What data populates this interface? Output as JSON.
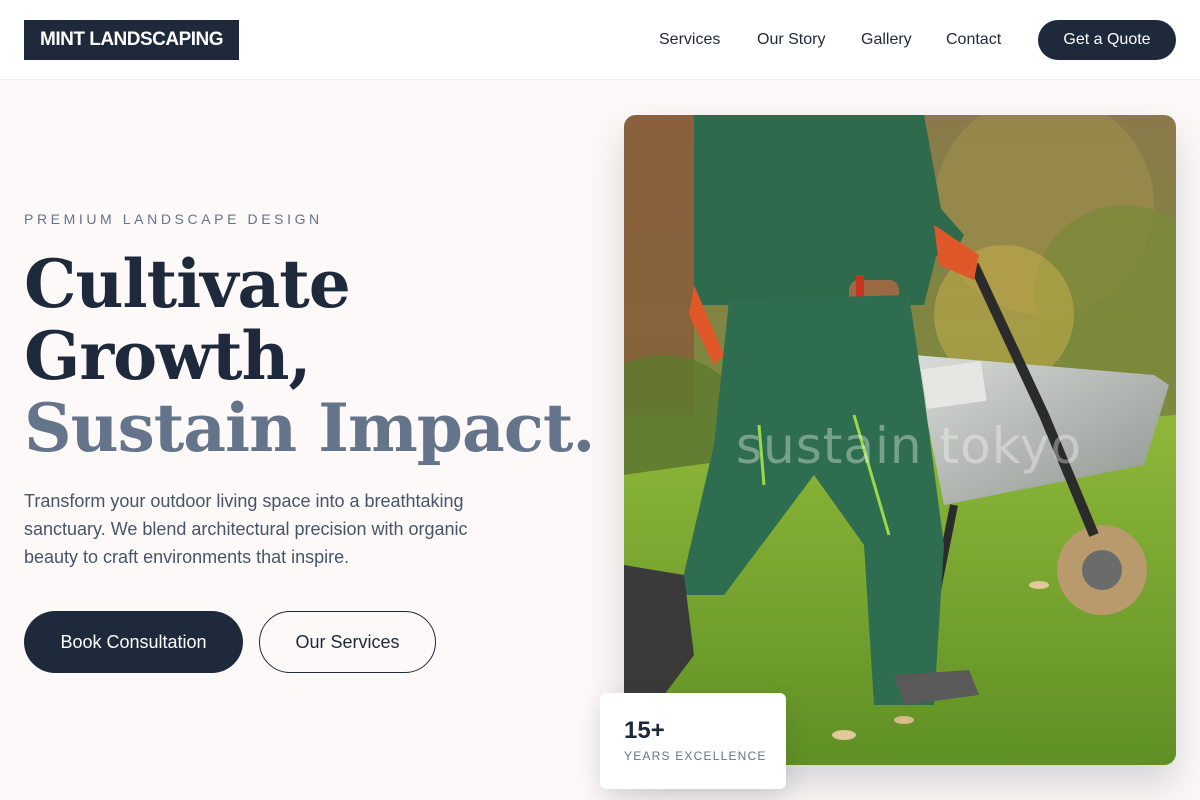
{
  "brand": {
    "logo_text": "MINT LANDSCAPING",
    "primary_color": "#1e293b",
    "muted_color": "#64748b",
    "background_color": "#fdf9f8"
  },
  "nav": {
    "items": [
      {
        "label": "Services"
      },
      {
        "label": "Our Story"
      },
      {
        "label": "Gallery"
      },
      {
        "label": "Contact"
      }
    ],
    "cta_label": "Get a Quote"
  },
  "hero": {
    "eyebrow": "PREMIUM LANDSCAPE DESIGN",
    "headline_line1": "Cultivate",
    "headline_line2": "Growth,",
    "headline_accent": "Sustain Impact.",
    "lead": "Transform your outdoor living space into a breathtaking sanctuary. We blend architectural precision with organic beauty to craft environments that inspire.",
    "primary_button": "Book Consultation",
    "secondary_button": "Our Services",
    "image_watermark": "sustain tokyo"
  },
  "stat": {
    "number": "15+",
    "label": "YEARS EXCELLENCE"
  }
}
